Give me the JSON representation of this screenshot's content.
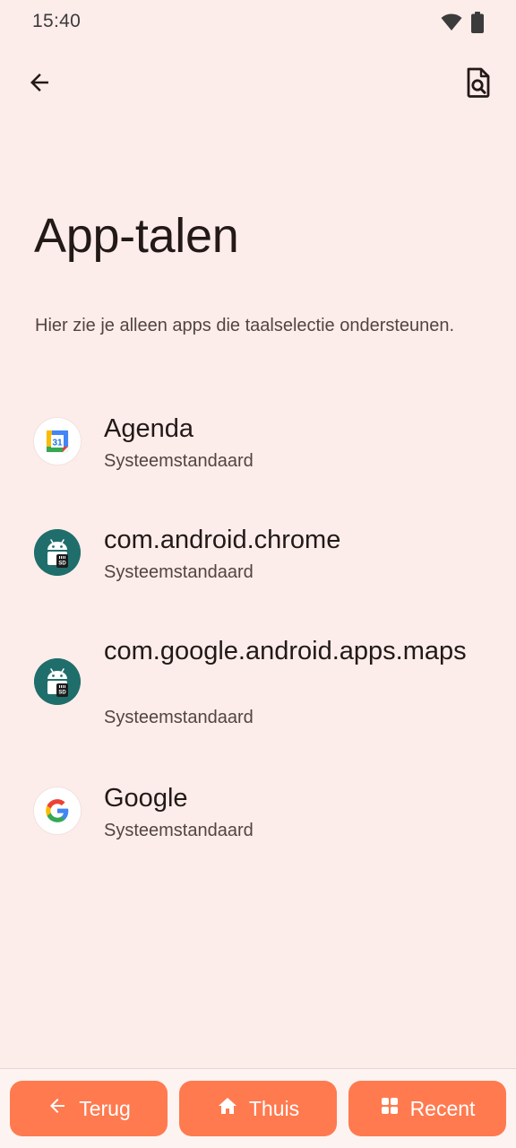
{
  "status_bar": {
    "time": "15:40",
    "icons": [
      "wifi-icon",
      "battery-icon"
    ]
  },
  "top_bar": {
    "back_icon": "back-arrow-icon",
    "search_icon": "search-document-icon"
  },
  "page": {
    "title": "App-talen",
    "subtitle": "Hier zie je alleen apps die taalselectie ondersteunen."
  },
  "apps": [
    {
      "name": "Agenda",
      "language": "Systeemstandaard",
      "icon": "calendar-icon"
    },
    {
      "name": "com.android.chrome",
      "language": "Systeemstandaard",
      "icon": "android-default-icon"
    },
    {
      "name": "com.google.android.apps.maps",
      "language": "Systeemstandaard",
      "icon": "android-default-icon"
    },
    {
      "name": "Google",
      "language": "Systeemstandaard",
      "icon": "google-icon"
    }
  ],
  "calendar_icon_day": "31",
  "bottom_nav": {
    "back_label": "Terug",
    "home_label": "Thuis",
    "recent_label": "Recent"
  },
  "colors": {
    "background": "#fcedea",
    "nav_button": "#ff7a4f",
    "android_icon_bg": "#1f6e6b"
  }
}
